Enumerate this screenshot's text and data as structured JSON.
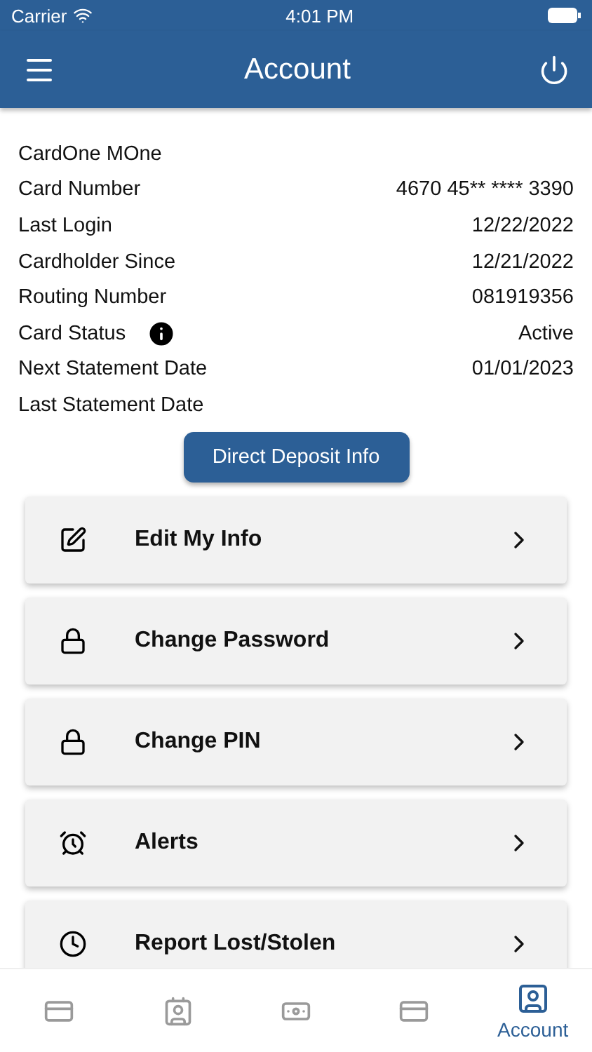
{
  "status_bar": {
    "carrier": "Carrier",
    "time": "4:01 PM"
  },
  "header": {
    "title": "Account"
  },
  "account": {
    "name": "CardOne MOne",
    "rows": [
      {
        "label": "Card Number",
        "value": "4670 45** **** 3390"
      },
      {
        "label": "Last Login",
        "value": "12/22/2022"
      },
      {
        "label": "Cardholder Since",
        "value": "12/21/2022"
      },
      {
        "label": "Routing Number",
        "value": "081919356"
      },
      {
        "label": "Card Status",
        "value": "Active",
        "info": true
      },
      {
        "label": "Next Statement Date",
        "value": "01/01/2023"
      },
      {
        "label": "Last Statement Date"
      }
    ]
  },
  "deposit_button": "Direct Deposit Info",
  "menu": [
    {
      "kind": "edit",
      "label": "Edit My Info"
    },
    {
      "kind": "lock",
      "label": "Change Password"
    },
    {
      "kind": "lock",
      "label": "Change PIN"
    },
    {
      "kind": "alarm",
      "label": "Alerts"
    },
    {
      "kind": "clock",
      "label": "Report Lost/Stolen"
    }
  ],
  "tabs": [
    {
      "kind": "card",
      "selected": false
    },
    {
      "kind": "contact",
      "selected": false
    },
    {
      "kind": "cash",
      "selected": false
    },
    {
      "kind": "addcard",
      "selected": false
    },
    {
      "kind": "account",
      "label": "Account",
      "selected": true
    }
  ]
}
